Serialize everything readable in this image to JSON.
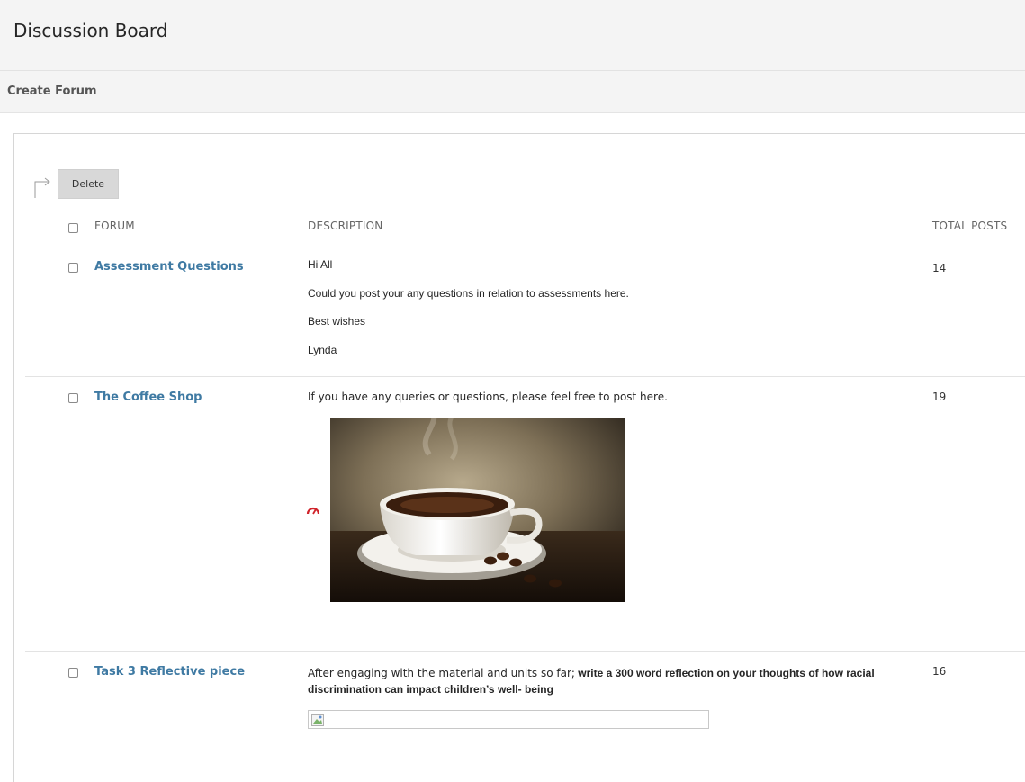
{
  "header": {
    "title": "Discussion Board"
  },
  "actions": {
    "create_forum": "Create Forum"
  },
  "toolbar": {
    "delete_label": "Delete"
  },
  "columns": {
    "forum": "FORUM",
    "description": "DESCRIPTION",
    "total_posts": "TOTAL POSTS"
  },
  "forums": [
    {
      "title": "Assessment Questions",
      "description": [
        "Hi All",
        "Could you post your any questions in relation to assessments here.",
        "Best wishes",
        "Lynda"
      ],
      "total_posts": "14"
    },
    {
      "title": "The Coffee Shop",
      "description": [
        "If you have any queries or questions, please feel free to post here."
      ],
      "image": "coffee-cup-image",
      "total_posts": "19"
    },
    {
      "title": "Task 3 Reflective piece",
      "description_lead": "After engaging with the material  and units so far;",
      "description_bold": "write a 300 word reflection on your thoughts of how racial discrimination can impact children’s well- being",
      "image": "broken-image-icon",
      "total_posts": "16"
    }
  ],
  "icons": {
    "select_arrow": "select-arrow-icon",
    "gauge": "gauge-icon"
  },
  "colors": {
    "link": "#3f7aa3",
    "header_bg": "#f4f4f4",
    "button_bg": "#d8d8d8",
    "gauge": "#d0242b"
  }
}
